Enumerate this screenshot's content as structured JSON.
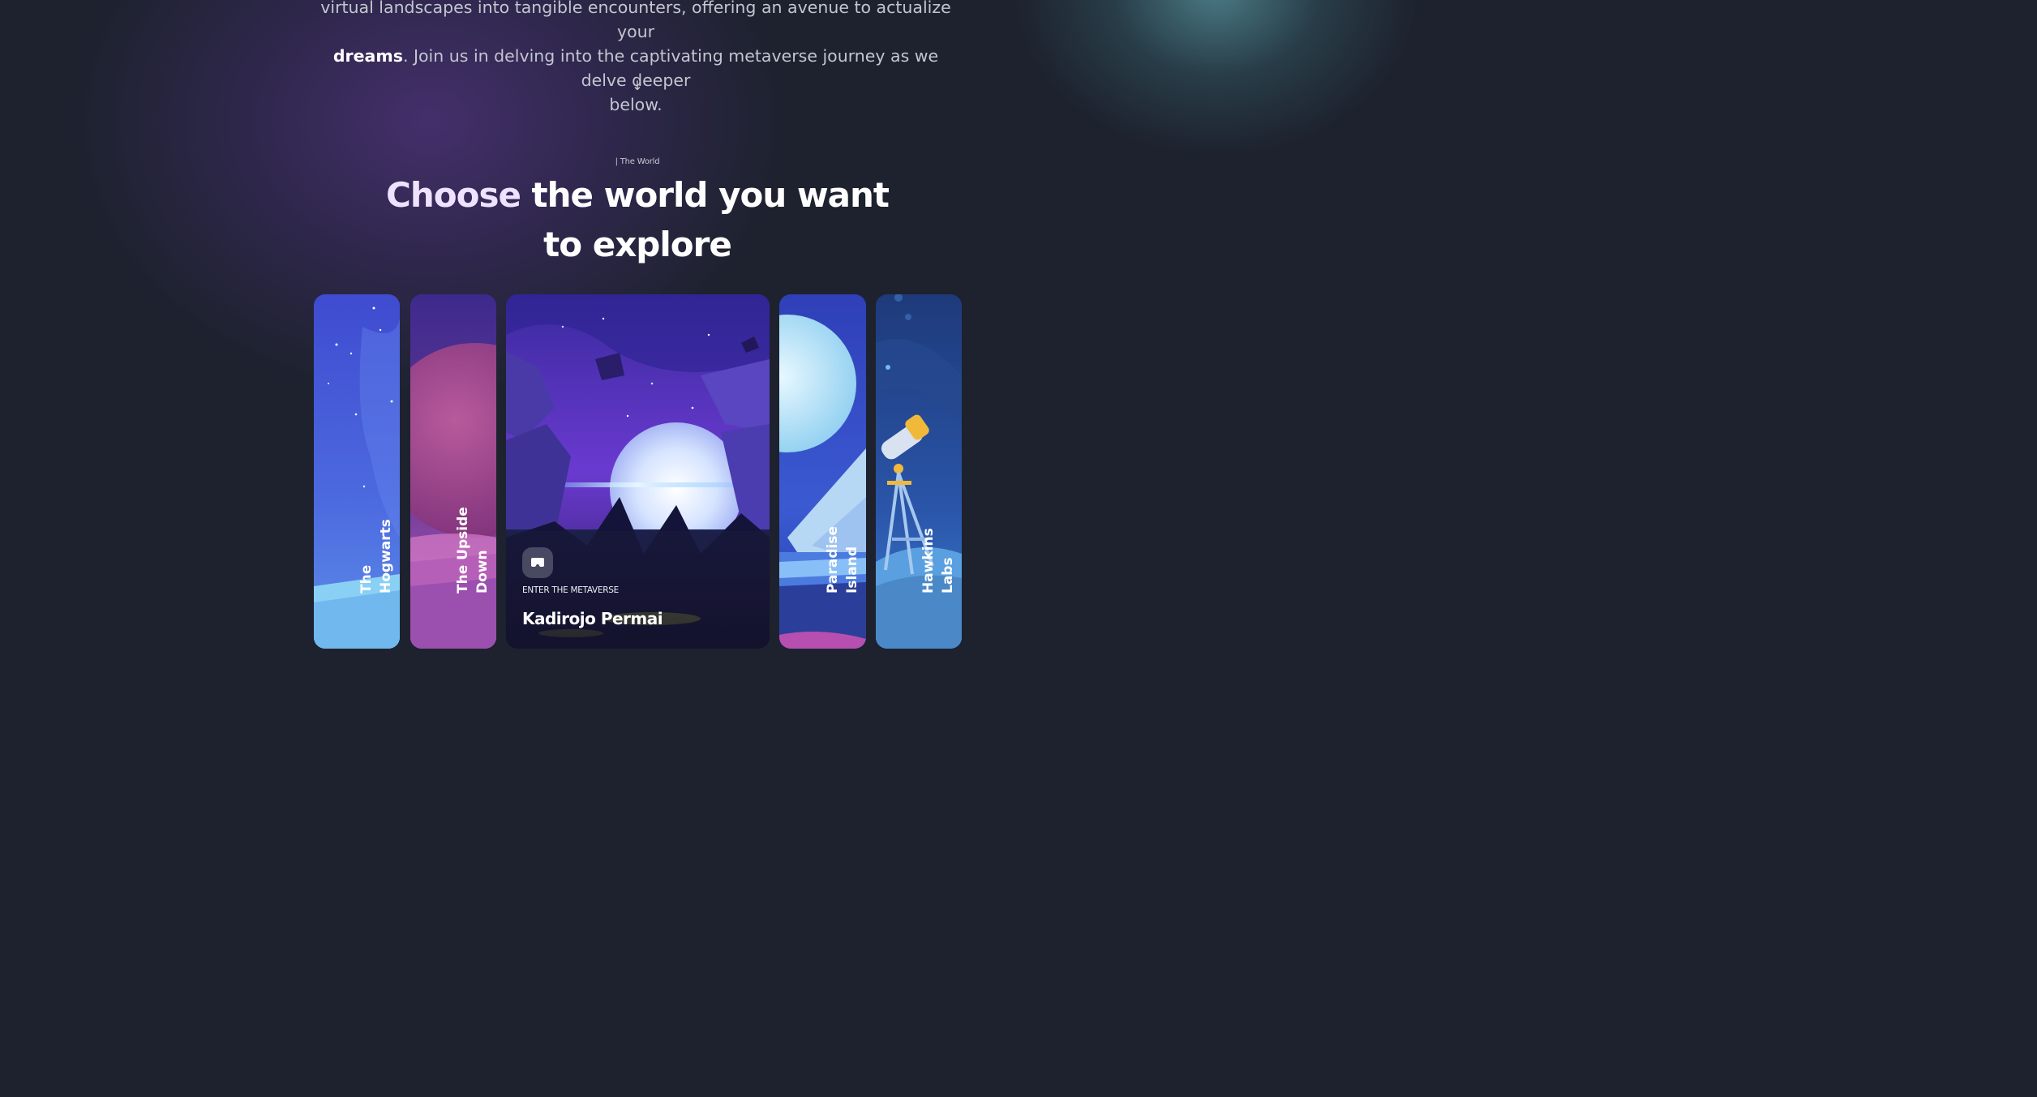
{
  "intro": {
    "line1": "virtual landscapes into tangible encounters, offering an avenue to actualize your",
    "bold_word": "dreams",
    "line2_rest": ". Join us in delving into the captivating metaverse journey as we delve deeper",
    "line3": "below.",
    "arrow": "↓"
  },
  "section": {
    "eyebrow": "| The World",
    "heading_accent": "Choose",
    "heading_rest_line1": " the world you want",
    "heading_line2": "to explore"
  },
  "worlds": [
    {
      "line1": "The",
      "line2": "Hogwarts"
    },
    {
      "line1": "The Upside",
      "line2": "Down"
    },
    {
      "name": "Kadirojo Permai",
      "cta": "ENTER THE METAVERSE",
      "icon": "vr-headset-icon"
    },
    {
      "line1": "Paradise",
      "line2": "Island"
    },
    {
      "line1": "Hawkins",
      "line2": "Labs"
    }
  ],
  "colors": {
    "background": "#1d222e",
    "heading_accent": "#eee2ff"
  }
}
